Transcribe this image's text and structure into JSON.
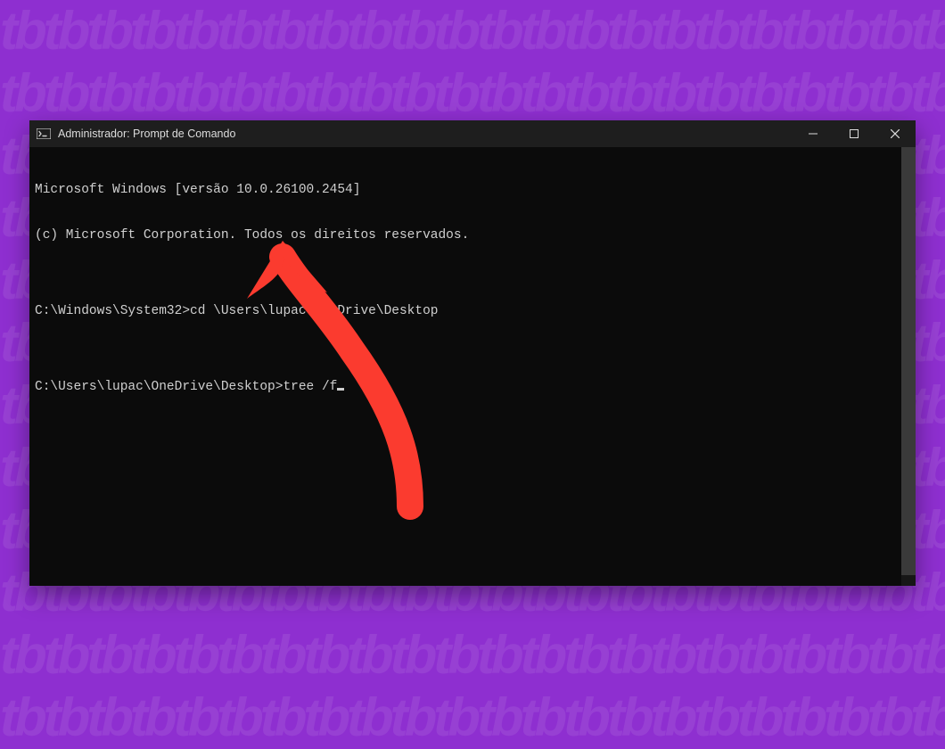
{
  "background": {
    "color": "#8e2fd0",
    "pattern_ghost_text": "tb"
  },
  "window": {
    "title": "Administrador: Prompt de Comando",
    "icon_name": "cmd-icon",
    "controls": {
      "minimize": "minimize",
      "maximize": "maximize",
      "close": "close"
    }
  },
  "terminal": {
    "lines": [
      "Microsoft Windows [versão 10.0.26100.2454]",
      "(c) Microsoft Corporation. Todos os direitos reservados.",
      "",
      "C:\\Windows\\System32>cd \\Users\\lupac\\OneDrive\\Desktop",
      "",
      "C:\\Users\\lupac\\OneDrive\\Desktop>tree /f"
    ],
    "current_command": "tree /f",
    "current_prompt": "C:\\Users\\lupac\\OneDrive\\Desktop>"
  },
  "annotation": {
    "kind": "arrow",
    "color": "#fb3b2f",
    "points_to": "current-command"
  }
}
